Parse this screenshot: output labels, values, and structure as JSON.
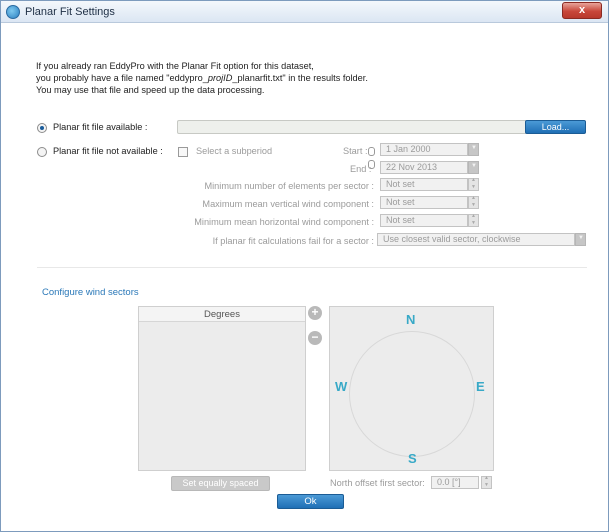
{
  "window": {
    "title": "Planar Fit Settings",
    "close_label": "x"
  },
  "intro": {
    "line1": "If you already ran EddyPro with the Planar Fit option for this dataset,",
    "line2_pre": "you probably have a file named \"eddypro_",
    "line2_em": "projID",
    "line2_post": "_planarfit.txt\" in the results folder.",
    "line3": "You may use that file and speed up the data processing."
  },
  "file_option": {
    "available_label": "Planar fit file available :",
    "available_selected": true,
    "file_path": "",
    "load_label": "Load...",
    "not_available_label": "Planar fit file not available :",
    "subperiod_label": "Select a subperiod",
    "subperiod_checked": false
  },
  "subperiod": {
    "start_label": "Start :",
    "start_value": "1 Jan 2000",
    "end_label": "End :",
    "end_value": "22 Nov 2013"
  },
  "settings": {
    "min_elements_label": "Minimum number of elements per sector :",
    "min_elements_value": "Not set",
    "max_vertical_label": "Maximum mean vertical wind component :",
    "max_vertical_value": "Not set",
    "min_horizontal_label": "Minimum mean horizontal wind component :",
    "min_horizontal_value": "Not set",
    "fail_label": "If planar fit calculations fail for a sector :",
    "fail_value": "Use closest valid sector, clockwise"
  },
  "wind_sectors": {
    "link_label": "Configure wind sectors",
    "degrees_header": "Degrees",
    "add_label": "+",
    "remove_label": "−",
    "compass": {
      "n": "N",
      "e": "E",
      "s": "S",
      "w": "W",
      "accent": "#38a9c7"
    },
    "set_equally_label": "Set equally spaced",
    "north_offset_label": "North offset first sector:",
    "north_offset_value": "0.0  [°]"
  },
  "ok_label": "Ok",
  "colors": {
    "accent_blue": "#1f6fb5",
    "link": "#2a78b8"
  }
}
